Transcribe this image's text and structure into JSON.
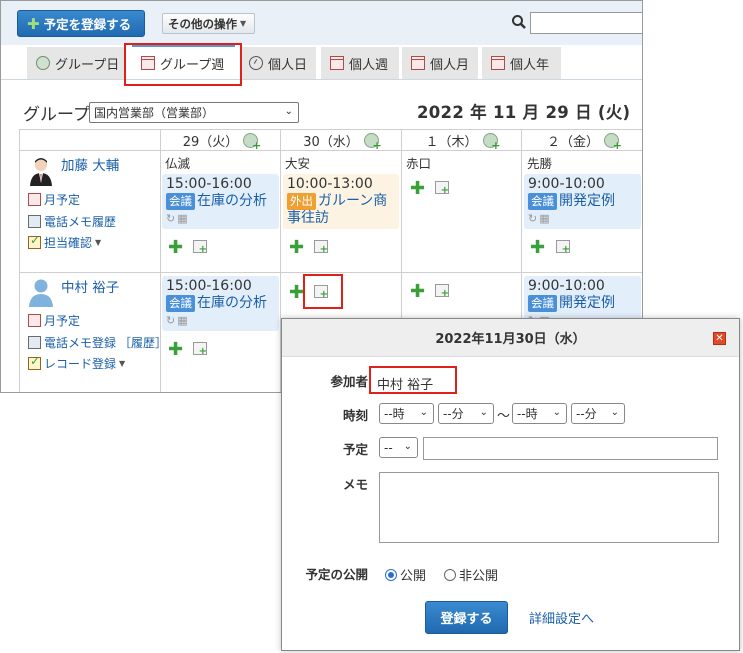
{
  "toolbar": {
    "register_label": "予定を登録する",
    "other_ops_label": "その他の操作",
    "search_placeholder": ""
  },
  "tabs": [
    {
      "label": "グループ日",
      "icon": "group-day-icon"
    },
    {
      "label": "グループ週",
      "icon": "group-week-icon",
      "active": true
    },
    {
      "label": "個人日",
      "icon": "clock-icon"
    },
    {
      "label": "個人週",
      "icon": "personal-week-icon"
    },
    {
      "label": "個人月",
      "icon": "calendar-icon"
    },
    {
      "label": "個人年",
      "icon": "calendar-icon"
    }
  ],
  "group": {
    "label": "グループ",
    "selected": "国内営業部（営業部）"
  },
  "date_title": "2022 年 11 月 29 日 (火)",
  "days": [
    {
      "label": "29（火）"
    },
    {
      "label": "30（水）"
    },
    {
      "label": "１（木）"
    },
    {
      "label": "２（金）"
    }
  ],
  "users": [
    {
      "name": "加藤 大輔",
      "links": [
        "月予定",
        "電話メモ履歴",
        "担当確認"
      ],
      "places": [
        "仏滅",
        "大安",
        "赤口",
        "先勝"
      ],
      "events": {
        "d29": {
          "time": "15:00-16:00",
          "tag": "会議",
          "title": "在庫の分析"
        },
        "d30": {
          "time": "10:00-13:00",
          "tag": "外出",
          "title": "ガルーン商事往訪"
        },
        "d2": {
          "time": "9:00-10:00",
          "tag": "会議",
          "title": "開発定例"
        }
      }
    },
    {
      "name": "中村 裕子",
      "links": [
        "月予定",
        "電話メモ登録",
        "［履歴］",
        "レコード登録"
      ],
      "events": {
        "d29": {
          "time": "15:00-16:00",
          "tag": "会議",
          "title": "在庫の分析"
        },
        "d2": {
          "time": "9:00-10:00",
          "tag": "会議",
          "title": "開発定例"
        }
      }
    }
  ],
  "dialog": {
    "title": "2022年11月30日（水）",
    "participant_label": "参加者",
    "participant": "中村 裕子",
    "time_label": "時刻",
    "time": {
      "start_hour": "--時",
      "start_min": "--分",
      "sep": "～",
      "end_hour": "--時",
      "end_min": "--分"
    },
    "subject_label": "予定",
    "subject_select": "--",
    "subject_value": "",
    "memo_label": "メモ",
    "memo_value": "",
    "visibility_label": "予定の公開",
    "public_label": "公開",
    "private_label": "非公開",
    "visibility_selected": "公開",
    "submit_label": "登録する",
    "detail_link": "詳細設定へ"
  },
  "colors": {
    "accent": "#2a7bc8",
    "highlight": "#e0201a",
    "link": "#1a5fa8"
  }
}
